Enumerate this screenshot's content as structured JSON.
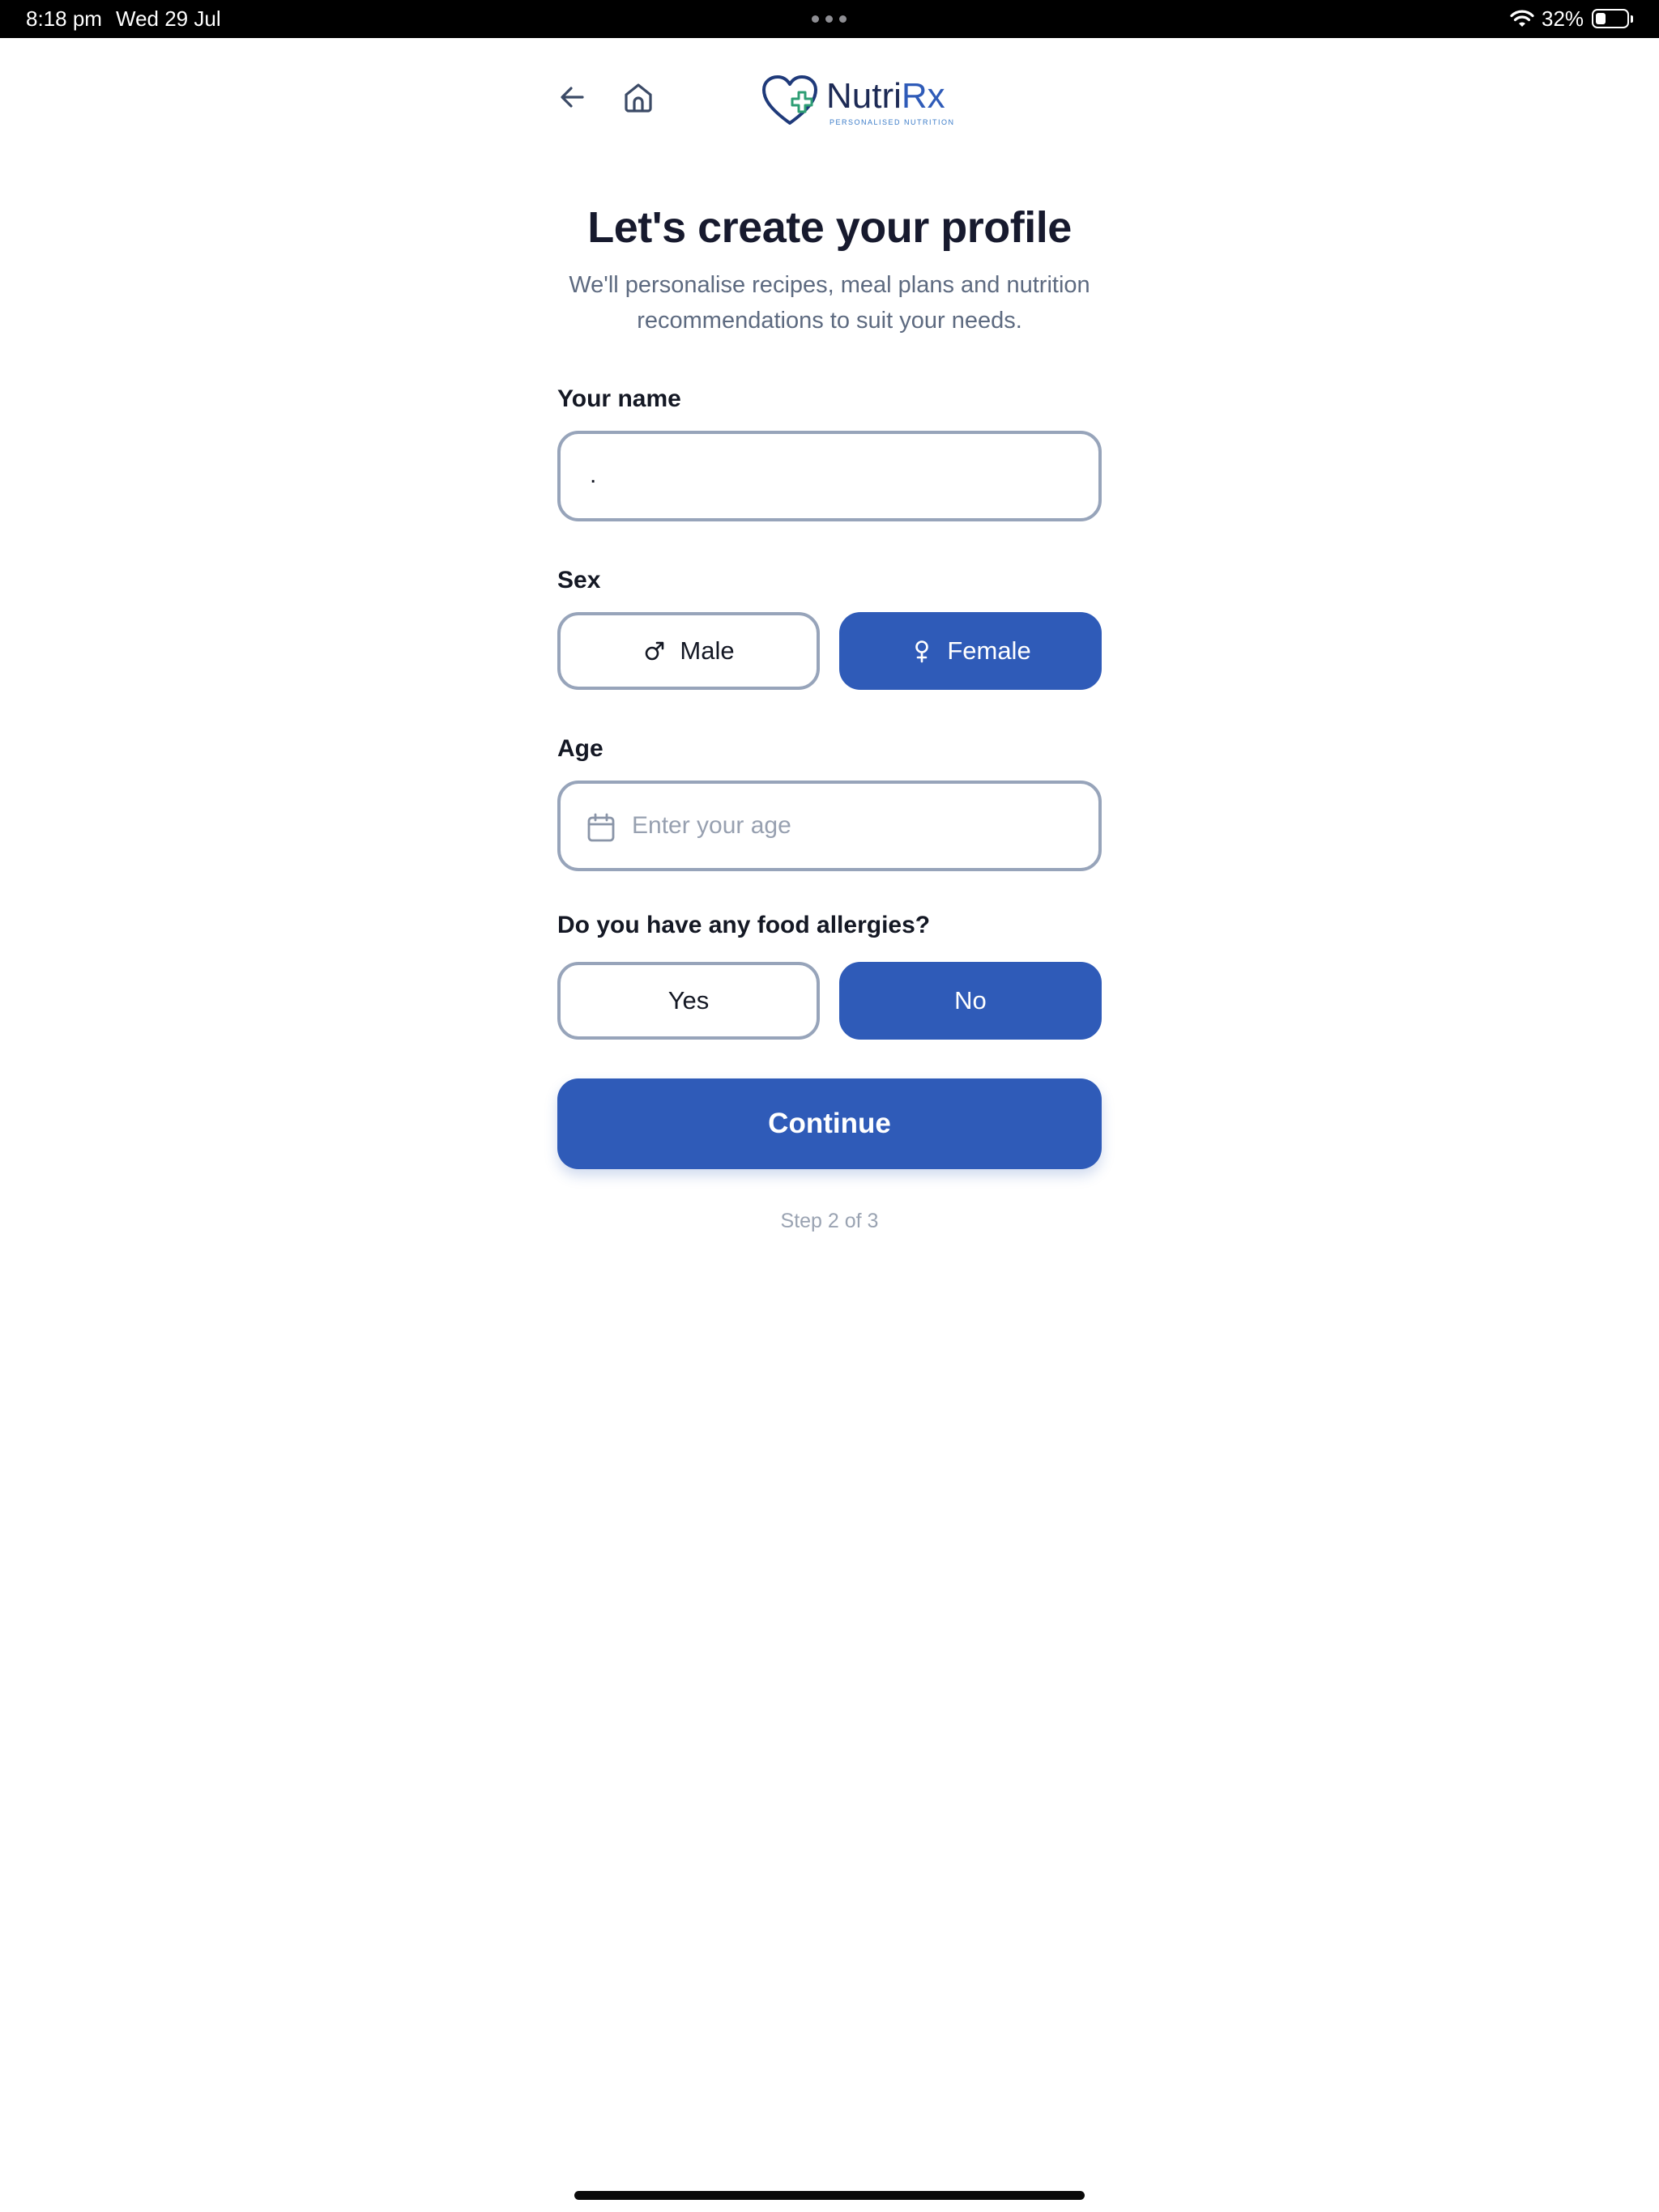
{
  "status_bar": {
    "time": "8:18 pm",
    "date": "Wed 29 Jul",
    "battery_percent": "32%",
    "battery_level": 0.32,
    "icons": [
      "multitasking-dots-icon",
      "wifi-icon",
      "battery-icon"
    ]
  },
  "header": {
    "back_icon": "arrow-left-icon",
    "home_icon": "home-icon",
    "logo": {
      "name_part1": "Nutri",
      "name_part2": "Rx",
      "tagline": "PERSONALISED NUTRITION",
      "icon": "heart-plus-icon"
    }
  },
  "page": {
    "title": "Let's create your profile",
    "subtitle_line1": "We'll personalise recipes, meal plans and nutrition",
    "subtitle_line2": "recommendations to suit your needs."
  },
  "form": {
    "name": {
      "label": "Your name",
      "value": "."
    },
    "sex": {
      "label": "Sex",
      "options": [
        {
          "label": "Male",
          "icon": "male-symbol-icon",
          "selected": false
        },
        {
          "label": "Female",
          "icon": "female-symbol-icon",
          "selected": true
        }
      ]
    },
    "age": {
      "label": "Age",
      "placeholder": "Enter your age",
      "value": "",
      "icon": "calendar-icon"
    },
    "allergies": {
      "label": "Do you have any food allergies?",
      "options": [
        {
          "label": "Yes",
          "selected": false
        },
        {
          "label": "No",
          "selected": true
        }
      ]
    }
  },
  "actions": {
    "continue_label": "Continue"
  },
  "progress": {
    "step_text": "Step 2 of 3"
  },
  "colors": {
    "primary": "#2f5bb8",
    "input_border": "#97a4ba",
    "title_text": "#171a2e",
    "muted_text": "#5d6a80",
    "step_text": "#9aa3b2"
  }
}
